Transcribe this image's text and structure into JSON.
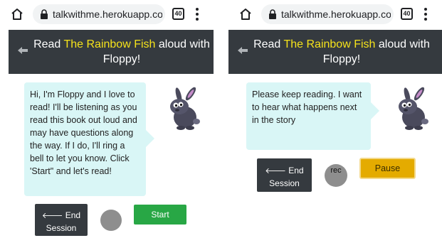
{
  "browser": {
    "url": "talkwithme.herokuapp.com/t",
    "tab_count": "40"
  },
  "header": {
    "prefix": "Read ",
    "book_title": "The Rainbow Fish",
    "suffix": " aloud with Floppy!"
  },
  "left_screen": {
    "message": "Hi, I'm Floppy and I love to read! I'll be listening as you read this book out loud and may have questions along the way. If I do, I'll ring a bell to let you know. Click 'Start\" and let's read!",
    "end_session_arrow": "🡐",
    "end_session_line1": "End",
    "end_session_line2": "Session",
    "start_label": "Start"
  },
  "right_screen": {
    "message": "Please keep reading. I want to hear what happens next in the story",
    "end_session_arrow": "🡐",
    "end_session_line1": "End",
    "end_session_line2": "Session",
    "rec_label": "rec",
    "pause_label": "Pause"
  },
  "colors": {
    "header_bg": "#353a3f",
    "book_title": "#f5e21b",
    "bubble_bg": "#d9f6f6",
    "start_green": "#28a745",
    "pause_amber": "#e4ab00",
    "rec_gray": "#8e8e8e"
  },
  "icons": [
    "home-icon",
    "lock-icon",
    "tabs-icon",
    "menu-icon",
    "back-arrow-icon",
    "bunny-icon"
  ]
}
